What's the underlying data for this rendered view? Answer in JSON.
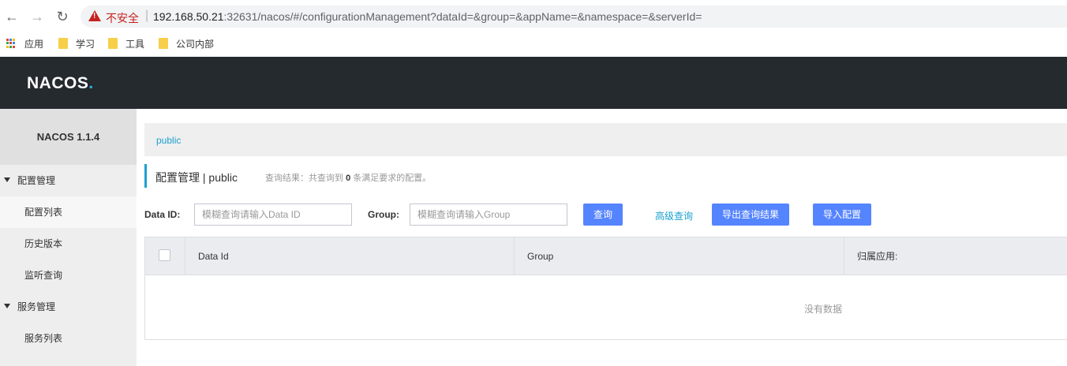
{
  "browser": {
    "back_icon": "←",
    "forward_icon": "→",
    "reload_icon": "↻",
    "security_label": "不安全",
    "url_host": "192.168.50.21",
    "url_rest": ":32631/nacos/#/configurationManagement?dataId=&group=&appName=&namespace=&serverId="
  },
  "bookmarks": [
    {
      "label": "应用"
    },
    {
      "label": "学习"
    },
    {
      "label": "工具"
    },
    {
      "label": "公司内部"
    }
  ],
  "header": {
    "logo_text": "NACOS",
    "logo_dot": "."
  },
  "sidebar": {
    "version": "NACOS 1.1.4",
    "groups": [
      {
        "label": "配置管理",
        "items": [
          "配置列表",
          "历史版本",
          "监听查询"
        ]
      },
      {
        "label": "服务管理",
        "items": [
          "服务列表"
        ]
      }
    ]
  },
  "main": {
    "namespace_tab": "public",
    "title": "配置管理  |  public",
    "result_prefix": "查询结果：共查询到 ",
    "result_count": "0",
    "result_suffix": " 条满足要求的配置。",
    "dataid_label": "Data ID:",
    "dataid_placeholder": "模糊查询请输入Data ID",
    "group_label": "Group:",
    "group_placeholder": "模糊查询请输入Group",
    "query_button": "查询",
    "advanced_link": "高级查询",
    "export_button": "导出查询结果",
    "import_button": "导入配置",
    "table": {
      "columns": [
        "Data Id",
        "Group",
        "归属应用:"
      ],
      "empty_text": "没有数据"
    }
  },
  "colors": {
    "accent": "#1ba1d0",
    "button": "#5584ff",
    "topbar": "#252a2f",
    "warning": "#c5221f"
  }
}
